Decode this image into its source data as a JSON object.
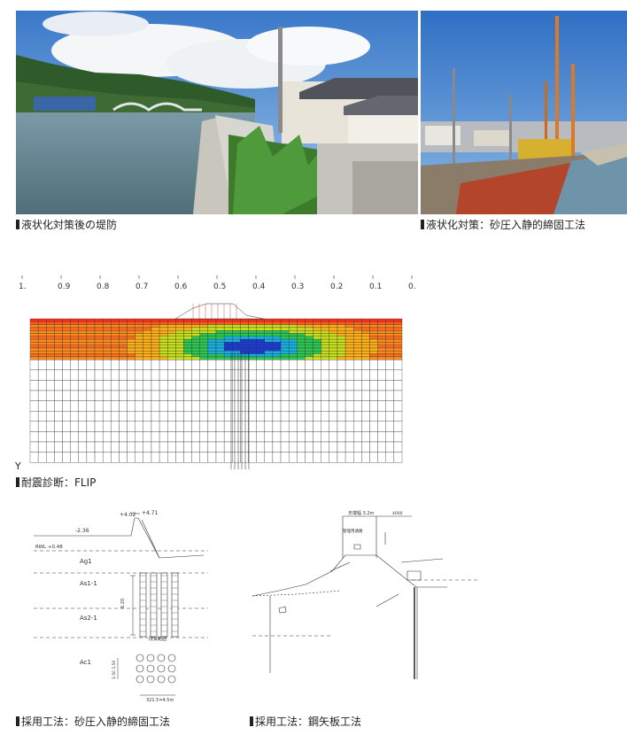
{
  "photos": {
    "left_caption": "液状化対策後の堤防",
    "right_caption": "液状化対策：砂圧入静的締固工法"
  },
  "colorbar": {
    "colors": [
      "#ff1a1a",
      "#ff4a1a",
      "#ff7a14",
      "#ffa814",
      "#ffd81a",
      "#e8f01a",
      "#a8e81a",
      "#5fd41a",
      "#1fc81a",
      "#14c880",
      "#14d8c8",
      "#14b8e8",
      "#1478e8",
      "#1440d8",
      "#2020c0",
      "#5050d0",
      "#8080e0",
      "#b8b8f0",
      "#ffffff"
    ],
    "ticks": [
      "1.",
      "0.9",
      "0.8",
      "0.7",
      "0.6",
      "0.5",
      "0.4",
      "0.3",
      "0.2",
      "0.1",
      "0."
    ]
  },
  "flip": {
    "caption": "耐震診断：FLIP",
    "axis_mark": "Y"
  },
  "drawing_left": {
    "caption": "採用工法：砂圧入静的締固工法",
    "labels": {
      "elev1": "+4.02",
      "elev2": "+4.71",
      "elev3": "-2.36",
      "rwl": "RWL +0.48",
      "ag1": "Ag1",
      "as1": "As1-1",
      "as2": "As2-1",
      "ac1": "Ac1",
      "depth": "6.20",
      "range": "改良範囲",
      "pitch": "1.50 1.50",
      "width": "321.5=4.5m"
    }
  },
  "drawing_right": {
    "caption": "採用工法：鋼矢板工法",
    "labels": {
      "top": "天端幅 3.2m",
      "road": "管理用通路",
      "width": "4000"
    }
  }
}
